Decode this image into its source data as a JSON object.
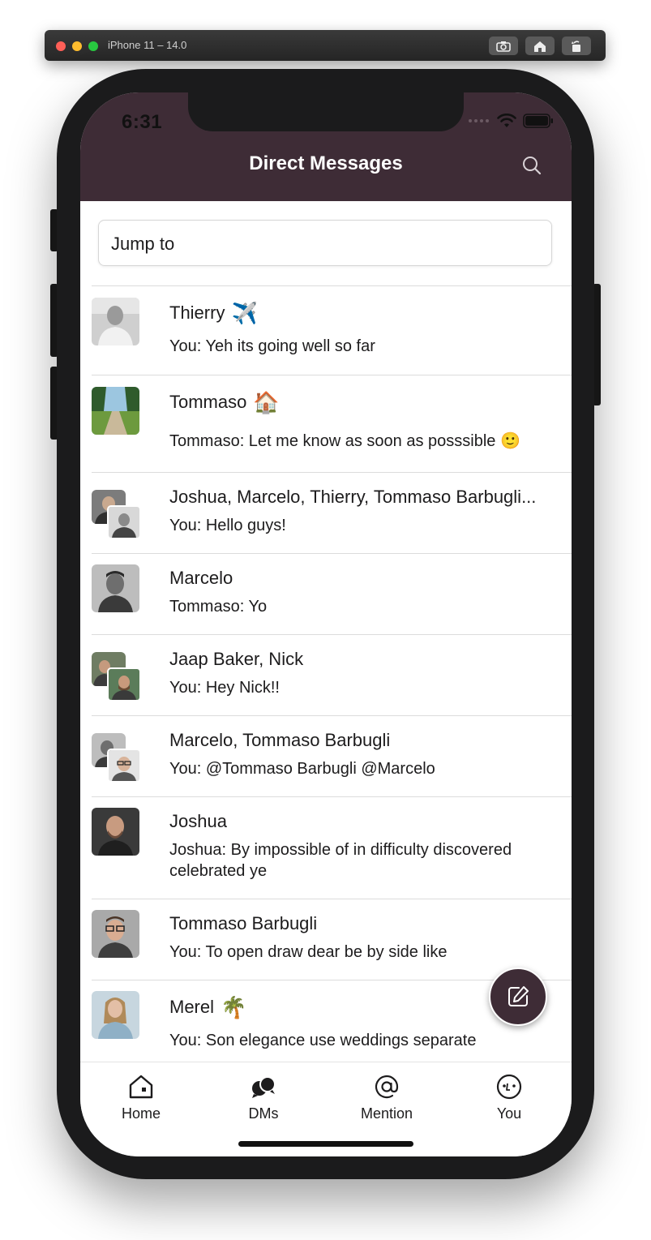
{
  "simulator": {
    "title": "iPhone 11 – 14.0"
  },
  "status_bar": {
    "time": "6:31"
  },
  "header": {
    "title": "Direct Messages"
  },
  "jump": {
    "placeholder": "Jump to"
  },
  "conversations": [
    {
      "name": "Thierry",
      "status_emoji": "✈️",
      "message": "You:  Yeh its going well so far"
    },
    {
      "name": "Tommaso",
      "status_emoji": "🏠",
      "message": "Tommaso: Let me know as soon as posssible 🙂"
    },
    {
      "name": "Joshua, Marcelo, Thierry, Tommaso Barbugli...",
      "status_emoji": "",
      "message": "You:  Hello guys!"
    },
    {
      "name": "Marcelo",
      "status_emoji": "",
      "message": "Tommaso: Yo"
    },
    {
      "name": "Jaap Baker, Nick",
      "status_emoji": "",
      "message": "You:  Hey Nick!!"
    },
    {
      "name": "Marcelo, Tommaso Barbugli",
      "status_emoji": "",
      "message": "You:  @Tommaso Barbugli @Marcelo"
    },
    {
      "name": "Joshua",
      "status_emoji": "",
      "message": "Joshua: By impossible of in difficulty discovered celebrated ye"
    },
    {
      "name": "Tommaso Barbugli",
      "status_emoji": "",
      "message": "You:  To open draw dear be by side like"
    },
    {
      "name": "Merel",
      "status_emoji": "🌴",
      "message": "You:  Son elegance use weddings separate"
    }
  ],
  "tabs": [
    {
      "label": "Home",
      "icon": "home-icon"
    },
    {
      "label": "DMs",
      "icon": "dms-icon"
    },
    {
      "label": "Mention",
      "icon": "at-icon"
    },
    {
      "label": "You",
      "icon": "you-icon"
    }
  ],
  "colors": {
    "header": "#3e2c36",
    "accent": "#3e2c36"
  }
}
